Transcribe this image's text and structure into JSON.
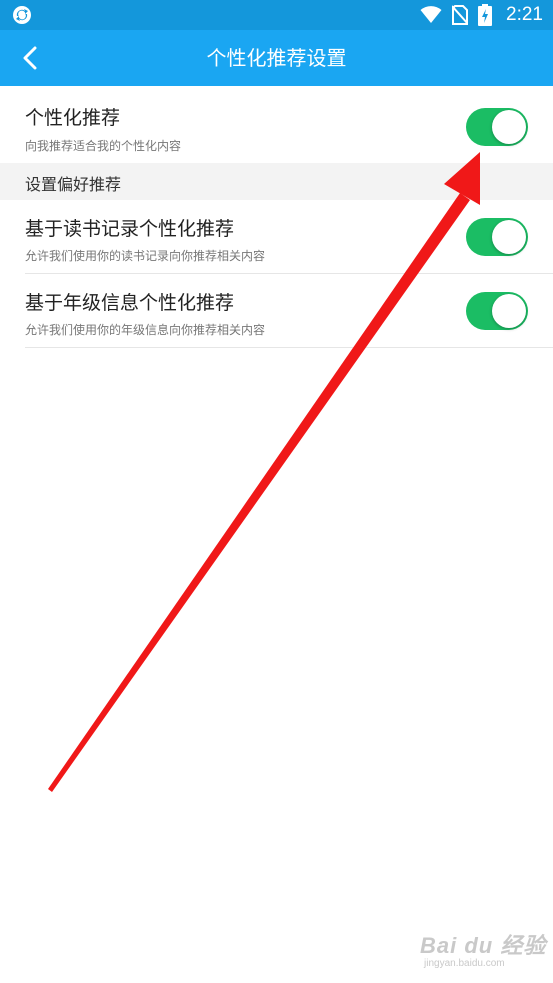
{
  "status_bar": {
    "time": "2:21",
    "icons": [
      "app-sync-icon",
      "wifi-icon",
      "no-sim-icon",
      "battery-charging-icon"
    ]
  },
  "header": {
    "title": "个性化推荐设置",
    "back_icon": "chevron-left-icon"
  },
  "main_setting": {
    "title": "个性化推荐",
    "subtitle": "向我推荐适合我的个性化内容",
    "enabled": true
  },
  "preferences": {
    "section_label": "设置偏好推荐",
    "items": [
      {
        "title": "基于读书记录个性化推荐",
        "subtitle": "允许我们使用你的读书记录向你推荐相关内容",
        "enabled": true
      },
      {
        "title": "基于年级信息个性化推荐",
        "subtitle": "允许我们使用你的年级信息向你推荐相关内容",
        "enabled": true
      }
    ]
  },
  "watermark": {
    "main": "Bai du 经验",
    "sub": "jingyan.baidu.com"
  },
  "colors": {
    "status_bar": "#1497db",
    "app_bar": "#1aa6f2",
    "toggle_on": "#1bbd64",
    "annotation_arrow": "#f01818"
  }
}
